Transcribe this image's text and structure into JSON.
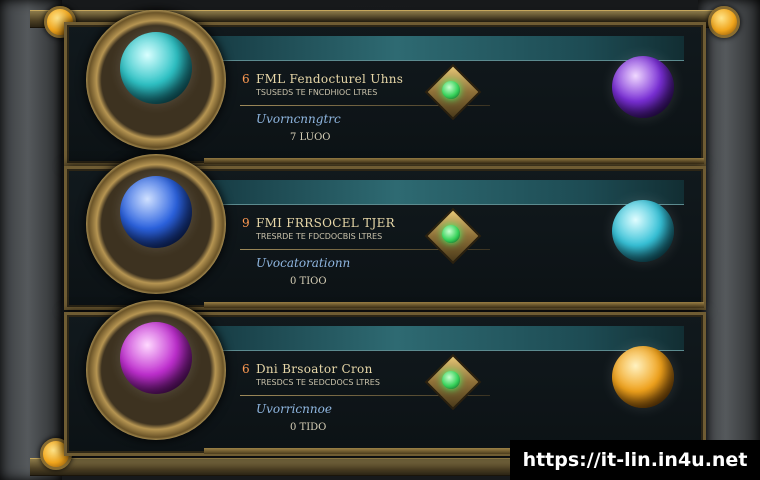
{
  "rows": [
    {
      "number": "6",
      "title": "FML Fendocturel Uhns",
      "subtitle": "TSUSEDS TE FNCDHIOC LTRES",
      "type": "Uvorncnngtrc",
      "count": "7 LUOO",
      "main_gem_color": "#2fc3c6",
      "right_gem_color": "#7a2fd6",
      "socket_orb": "green"
    },
    {
      "number": "9",
      "title": "FMI FRRSOCEL TJER",
      "subtitle": "TRESRDE TE FDCDOCBIS LTRES",
      "type": "Uvocatorationn",
      "count": "0 TIOO",
      "main_gem_color": "#2c63e0",
      "right_gem_color": "#37c2d8",
      "socket_orb": "green"
    },
    {
      "number": "6",
      "title": "Dni Brsoator Cron",
      "subtitle": "TRESDCS TE SEDCDOCS LTRES",
      "type": "Uvorricnnoe",
      "count": "0 TIDO",
      "main_gem_color": "#c02fd0",
      "right_gem_color": "#f0a21c",
      "socket_orb": "green"
    }
  ],
  "watermark": "https://it-lin.in4u.net"
}
